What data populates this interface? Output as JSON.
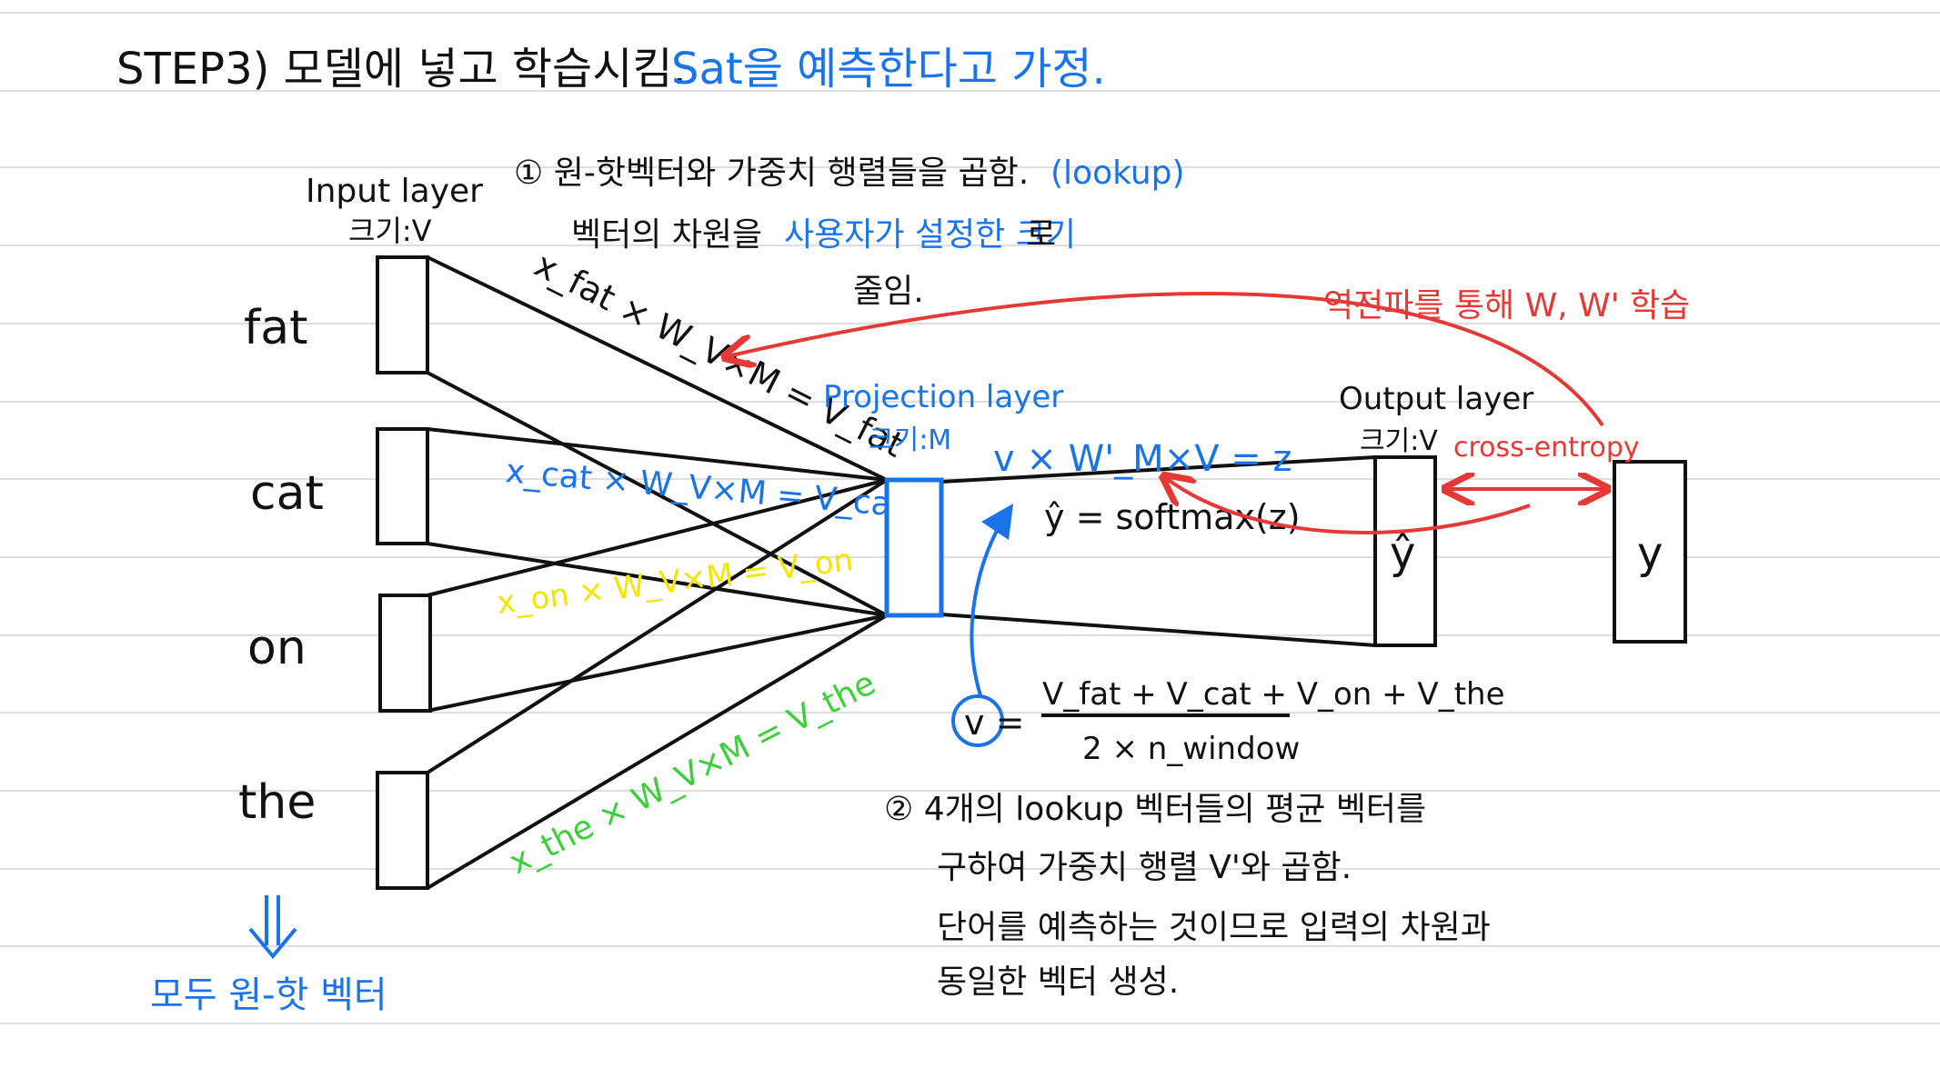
{
  "colors": {
    "ink": "#111111",
    "blue": "#1a73e8",
    "red": "#e53935",
    "yellow": "#f2e600",
    "green": "#3ccf3c",
    "rule": "#dedede"
  },
  "header": {
    "step": "STEP3)  모델에 넣고 학습시킴.",
    "assume": "Sat을 예측한다고 가정."
  },
  "notes": {
    "note1_line1": "① 원-핫벡터와 가중치 행렬들을 곱함.",
    "note1_lookup": "(lookup)",
    "note1_line2a": "벡터의 차원을",
    "note1_line2b": "사용자가 설정한 크기",
    "note1_line2c": "로",
    "note1_line3": "줄임.",
    "note2_line1": "② 4개의 lookup 벡터들의 평균 벡터를",
    "note2_line2": "구하여 가중치 행렬 V'와 곱함.",
    "note2_line3": "단어를 예측하는 것이므로 입력의 차원과",
    "note2_line4": "동일한 벡터 생성."
  },
  "input_layer": {
    "title": "Input layer",
    "size": "크기:V",
    "words": [
      "fat",
      "cat",
      "on",
      "the"
    ],
    "footer": "모두 원-핫 벡터"
  },
  "projection_layer": {
    "title": "Projection layer",
    "size": "크기:M"
  },
  "output_layer": {
    "title": "Output layer",
    "size": "크기:V",
    "yhat": "ŷ"
  },
  "target": {
    "label": "y"
  },
  "equations": {
    "fat": "x_fat × W_V×M = V_fat",
    "cat": "x_cat × W_V×M = V_cat",
    "on": "x_on × W_V×M = V_on",
    "the": "x_the × W_V×M = V_the",
    "output_z": "v × W'_M×V = z",
    "softmax": "ŷ = softmax(z)",
    "avg_lhs": "v =",
    "avg_numerator": "V_fat + V_cat + V_on + V_the",
    "avg_denominator": "2 × n_window"
  },
  "labels": {
    "backprop": "역전파를 통해 W, W' 학습",
    "cross_entropy": "cross-entropy"
  }
}
